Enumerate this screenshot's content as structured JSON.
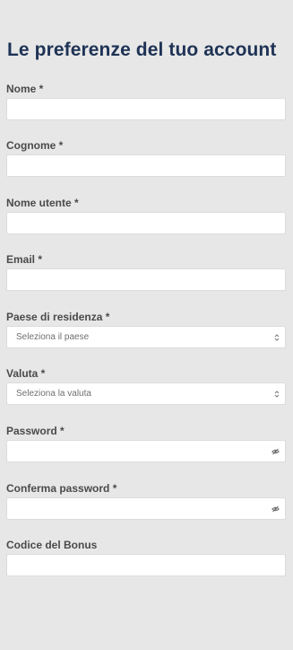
{
  "page": {
    "title": "Le preferenze del tuo account"
  },
  "fields": {
    "nome": {
      "label": "Nome *"
    },
    "cognome": {
      "label": "Cognome *"
    },
    "nome_utente": {
      "label": "Nome utente *"
    },
    "email": {
      "label": "Email *"
    },
    "paese": {
      "label": "Paese di residenza *",
      "placeholder": "Seleziona il paese"
    },
    "valuta": {
      "label": "Valuta *",
      "placeholder": "Seleziona la valuta"
    },
    "password": {
      "label": "Password *"
    },
    "conferma_password": {
      "label": "Conferma password *"
    },
    "codice_bonus": {
      "label": "Codice del Bonus"
    }
  },
  "icons": {
    "select_arrow": "updown-chevron-icon",
    "password_toggle": "eye-slash-icon"
  },
  "colors": {
    "background": "#e7e7e7",
    "title": "#1e3355",
    "label": "#4a4a4a",
    "input_bg": "#ffffff",
    "input_border": "#dcdcdc"
  }
}
